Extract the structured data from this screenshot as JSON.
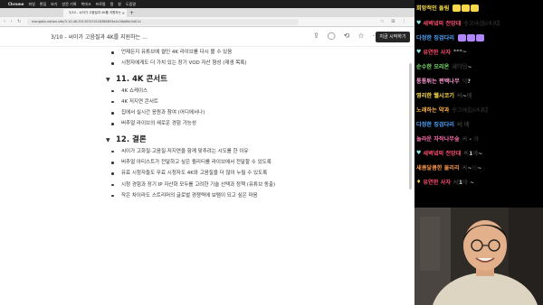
{
  "menubar": {
    "apple": "",
    "app": "Chrome",
    "items": [
      "파일",
      "편집",
      "보기",
      "방문 기록",
      "북마크",
      "프로필",
      "탭",
      "창",
      "도움말"
    ]
  },
  "browser": {
    "tab_title": "3/10 - 씨이가 고음질과 4K를 지원하는 …",
    "tab_close": "×",
    "new_tab": "+",
    "nav": "‹ › ↻",
    "url": "mangata-notion.site/3-10-4K-3513031f1528386893a4c26a86c04014",
    "icons": "☆ ⊞ ⋮"
  },
  "header": {
    "breadcrumb": "3/10 - 씨이가 고음질과 4K를 지원하는 ...",
    "icons": {
      "share": "⇪",
      "comment": "◯",
      "history": "⟲",
      "favorite": "☆",
      "more": "⋯"
    },
    "start_button": "지금 시작하기"
  },
  "document": {
    "intro_bullets": [
      "언제든지 유튜브에 썰인 4K 라이브를 다시 볼 수 있음",
      "시청자에게도 더 가치 있는 장기 VOD 자산 형성 (재생 목록)"
    ],
    "section11": {
      "triangle": "▼",
      "title": "11. 4K 콘서트",
      "bullets": [
        "4K 쇼케이스",
        "4K 저지연 콘서트",
        "집에서 실시간 응원과 참여 (어디에서나)",
        "버추얼 라이브의 새로운 경험 가능성"
      ]
    },
    "section12": {
      "triangle": "▼",
      "title": "12. 결론",
      "bullets": [
        "씨이가 고화질·고음질·저지연을 함께 맞추려는 시도를 한 이유",
        "버추얼 아티스트가 전달하고 싶은 퀄리티를 라이브에서 전달할 수 있도록",
        "유료 시청자들도 무료 시청자도 4K와 고음질을 더 많이 누릴 수 있도록",
        "시청 경험과 장기 IP 자산화 모두를 고려한 기술 선택과 정책 (유튜브 동출)",
        "작은 차이라도 스트리머의 글로벌 경쟁력에 보탬이 되고 싶은 마음"
      ]
    }
  },
  "chat": {
    "messages": [
      {
        "prefix": "",
        "nick": "희망적인 돌림",
        "nick_color": "#ffe14d",
        "text": "",
        "emotes": [
          "#f7d84a",
          "#f7d84a",
          "#f7d84a"
        ]
      },
      {
        "prefix": "heart",
        "nick": "새벽녘의 전망대",
        "nick_color": "#ff4d6d",
        "text": "수고하셨습니다",
        "emotes": []
      },
      {
        "prefix": "",
        "nick": "다정한 징검다리",
        "nick_color": "#4da6ff",
        "text": "",
        "emotes": [
          "#b086ff",
          "#b086ff",
          "#b086ff"
        ]
      },
      {
        "prefix": "heart",
        "nick": "유연한 사자",
        "nick_color": "#ff4d6d",
        "text": "***~",
        "emotes": []
      },
      {
        "prefix": "",
        "nick": "순수한 오리온",
        "nick_color": "#7be36b",
        "text": "화이팅~",
        "emotes": []
      },
      {
        "prefix": "",
        "nick": "통통튀는 편백나무",
        "nick_color": "#ff9ad5",
        "text": "예?",
        "emotes": []
      },
      {
        "prefix": "",
        "nick": "영리한 웰시코기",
        "nick_color": "#ffe14d",
        "text": "씨~바",
        "emotes": []
      },
      {
        "prefix": "",
        "nick": "노래하는 약과",
        "nick_color": "#ffb347",
        "text": "수고하셨습니다",
        "emotes": []
      },
      {
        "prefix": "",
        "nick": "다정한 징검다리",
        "nick_color": "#4da6ff",
        "text": "씨 바",
        "emotes": []
      },
      {
        "prefix": "",
        "nick": "놀라운 자작나무숲",
        "nick_color": "#ff6fae",
        "text": "씨 - 바",
        "emotes": []
      },
      {
        "prefix": "heart",
        "nick": "새벽녘의 전망대",
        "nick_color": "#ff4d6d",
        "text": "씨1바~",
        "emotes": []
      },
      {
        "prefix": "",
        "nick": "새콤달콤한 물리리",
        "nick_color": "#ff9a4d",
        "text": "씨~바~",
        "emotes": []
      },
      {
        "prefix": "bell",
        "nick": "유연한 사자",
        "nick_color": "#ff4d6d",
        "text": "씨1바 ~",
        "emotes": []
      }
    ]
  },
  "colors": {
    "start_button_bg": "#262626",
    "doc_bg": "#ffffff",
    "chat_bg": "#000000"
  }
}
